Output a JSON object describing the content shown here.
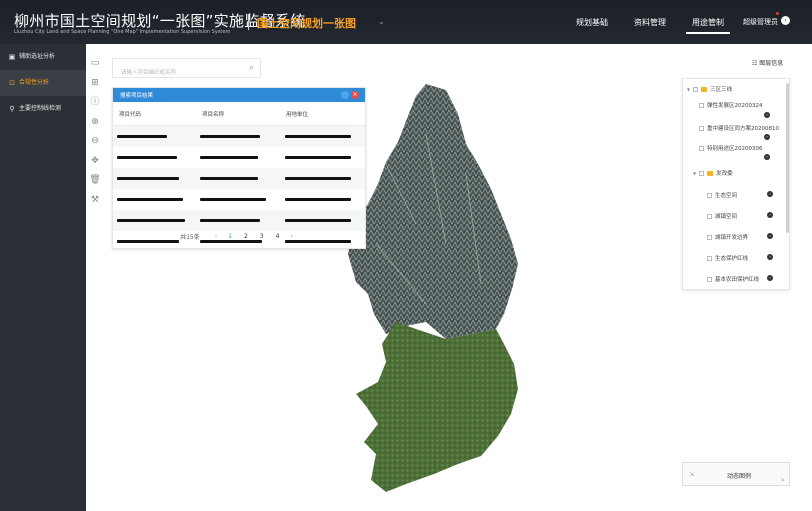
{
  "header": {
    "title": "柳州市国土空间规划“一张图”实施监督系统",
    "subtitle": "Liuzhou City Land and Space Planning \"One Map\" Implementation Supervision System",
    "module": "国土空间规划一张图",
    "nav": [
      {
        "label": "规划基础",
        "active": false
      },
      {
        "label": "资料管理",
        "active": false
      },
      {
        "label": "用途管制",
        "active": true
      }
    ],
    "user": "超级管理员"
  },
  "sidebar": {
    "items": [
      {
        "label": "辅助选址分析",
        "icon": "select-icon",
        "active": false
      },
      {
        "label": "合规性分析",
        "icon": "compliance-icon",
        "active": true
      },
      {
        "label": "主要控制线检测",
        "icon": "detect-icon",
        "active": false
      }
    ]
  },
  "toolbar": {
    "tools": [
      "layers-icon",
      "grid-icon",
      "info-icon",
      "zoom-in-icon",
      "zoom-out-icon",
      "pan-icon",
      "trash-icon",
      "wrench-icon"
    ]
  },
  "search": {
    "placeholder": "请输入项目编码或名称"
  },
  "results": {
    "title": "搜索项目结果",
    "columns": [
      "项目代码",
      "项目名称",
      "用地单位"
    ],
    "rows": 6,
    "pager": {
      "total": "共15条",
      "pages": [
        "1",
        "2",
        "3",
        "4"
      ],
      "current": "1",
      "prev": "‹",
      "next": "›"
    }
  },
  "layers": {
    "button": "图层信息",
    "groups": [
      {
        "label": "三区三线",
        "items": [
          "弹性发展区20200324",
          "重中建设区同方案20200810",
          "特别用途区20200306"
        ]
      },
      {
        "label": "发改委",
        "items": [
          "生态空间",
          "城镇空间",
          "城镇开发边界",
          "生态保护红线",
          "基本农田保护红线"
        ]
      }
    ]
  },
  "legend": {
    "label": "动态图例"
  },
  "colors": {
    "header_bg": "#1b1f27",
    "accent_orange": "#f5a020",
    "panel_blue": "#2f8bd8",
    "sidebar_bg": "#2b2f36"
  }
}
